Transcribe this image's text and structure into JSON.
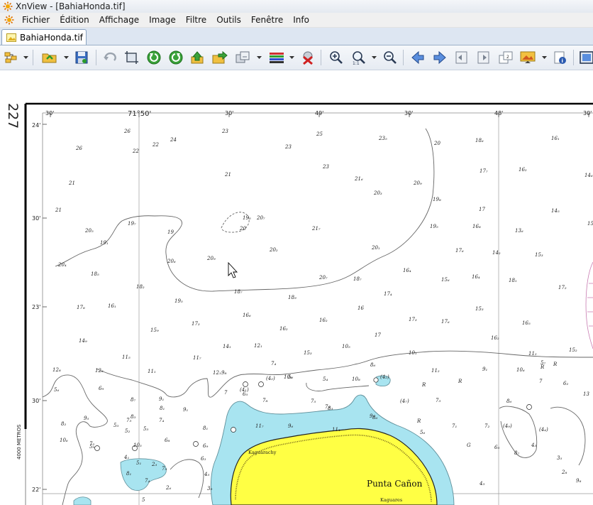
{
  "window": {
    "title": "XnView - [BahiaHonda.tif]"
  },
  "menu": {
    "items": [
      "Fichier",
      "Édition",
      "Affichage",
      "Image",
      "Filtre",
      "Outils",
      "Fenêtre",
      "Info"
    ]
  },
  "tab": {
    "label": "BahiaHonda.tif"
  },
  "toolbar": {
    "buttons": [
      "browser",
      "open",
      "save",
      "undo",
      "crop",
      "rotate-left",
      "rotate-right",
      "up",
      "next-folder",
      "convert",
      "adjust",
      "delete",
      "zoom-in",
      "zoom-fit",
      "zoom-out",
      "prev",
      "next",
      "first",
      "last",
      "multipage",
      "slideshow",
      "info",
      "fullscreen"
    ]
  },
  "map": {
    "sheet_number": "227",
    "scale_label": "4000 METROS",
    "top_ticks": [
      "30'",
      "71°50'",
      "30'",
      "49'",
      "30'",
      "48'",
      "30'"
    ],
    "lat_ticks": [
      "24'",
      "30'",
      "23'",
      "30'",
      "22'"
    ],
    "place_name": "Punta Cañon",
    "place_names_small": [
      "Kaguarachy",
      "Kaguares"
    ],
    "soundings": [
      "26",
      "22",
      "22",
      "24",
      "23",
      "25",
      "23₅",
      "20",
      "18₆",
      "16₁",
      "26",
      "23",
      "23",
      "17₇",
      "16₂",
      "14₆",
      "21",
      "21",
      "21₆",
      "20₃",
      "20₉",
      "19₈",
      "17",
      "14₅",
      "21",
      "19₇",
      "19",
      "19₅",
      "20₇",
      "21₇",
      "19₅",
      "16₈",
      "13₆",
      "15₁",
      "20₅",
      "19₁",
      "20",
      "20₂",
      "20₁",
      "17₆",
      "14₂",
      "15₃",
      "20₄",
      "18₅",
      "20₆",
      "20₉",
      "20₇",
      "18₇",
      "18₉",
      "16₄",
      "15₆",
      "16₄",
      "18₁",
      "17₂",
      "18₂",
      "19₅",
      "18₇",
      "17₄",
      "17₈",
      "16₁",
      "17₃",
      "16₆",
      "16",
      "16₂",
      "16₂",
      "17₃",
      "17₆",
      "15₃",
      "16₅",
      "15₉",
      "17",
      "16₂",
      "14₉",
      "14₁",
      "12₁",
      "15₃",
      "10₅",
      "11₅",
      "10₁",
      "11₂",
      "15₂",
      "12₈",
      "12₆",
      "11₁",
      "11₇",
      "12₁",
      "9₈",
      "8₆",
      "7₄",
      "5₆",
      "6₉",
      "8₇",
      "9₁",
      "10₁",
      "10₈",
      "10₆",
      "11₂",
      "9₁",
      "(4₁)",
      "(4₂)",
      "(4₂)",
      "7",
      "6₅",
      "5₆",
      "5₄",
      "5₇",
      "R",
      "R",
      "R",
      "R",
      "7",
      "8₁",
      "9₁",
      "7₈",
      "7₅",
      "8₃",
      "(4₇)",
      "7₃",
      "6₂",
      "13",
      "9₅",
      "8₃",
      "7₄",
      "7₃",
      "8₆",
      "7₁",
      "7₂",
      "5₃",
      "5₂",
      "5₃",
      "8₁",
      "11₇",
      "9₆",
      "11₄",
      "9₂",
      "(4₉)",
      "(4₄)",
      "8₂",
      "7₂",
      "6₈",
      "5₆",
      "8₆",
      "5₉",
      "10₅",
      "6₉",
      "R",
      "G",
      "6₅",
      "7₅",
      "10₆",
      "8₇",
      "4₃",
      "3₅",
      "2₈",
      "5₁",
      "7₉",
      "4₁",
      "2₃",
      "8₁",
      "7₄",
      "2₆",
      "3₉",
      "4₃",
      "6₃",
      "4₅",
      "5",
      "9₈"
    ]
  }
}
